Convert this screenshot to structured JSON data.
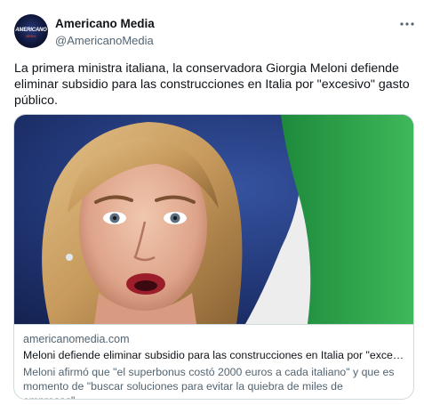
{
  "author": {
    "display_name": "Americano Media",
    "handle": "@AmericanoMedia",
    "avatar_text": "AMERICANO",
    "avatar_subtext": "MEDIA"
  },
  "more_icon": "ellipsis-icon",
  "tweet": {
    "text": "La primera ministra italiana, la conservadora Giorgia Meloni defiende eliminar subsidio para las construcciones en Italia por \"excesivo\" gasto público."
  },
  "card": {
    "domain": "americanomedia.com",
    "title": "Meloni defiende eliminar subsidio para las construcciones en Italia por \"exce…",
    "description": "Meloni afirmó que \"el superbonus costó 2000 euros a cada italiano\" y que es momento de \"buscar soluciones para evitar la quiebra de miles de empresas\"…"
  },
  "colors": {
    "text_primary": "#0f1419",
    "text_secondary": "#536471",
    "border": "#cfd9de",
    "flag_green": "#2fa14a",
    "flag_white": "#f2f2f2",
    "image_background": "#233a7a"
  }
}
